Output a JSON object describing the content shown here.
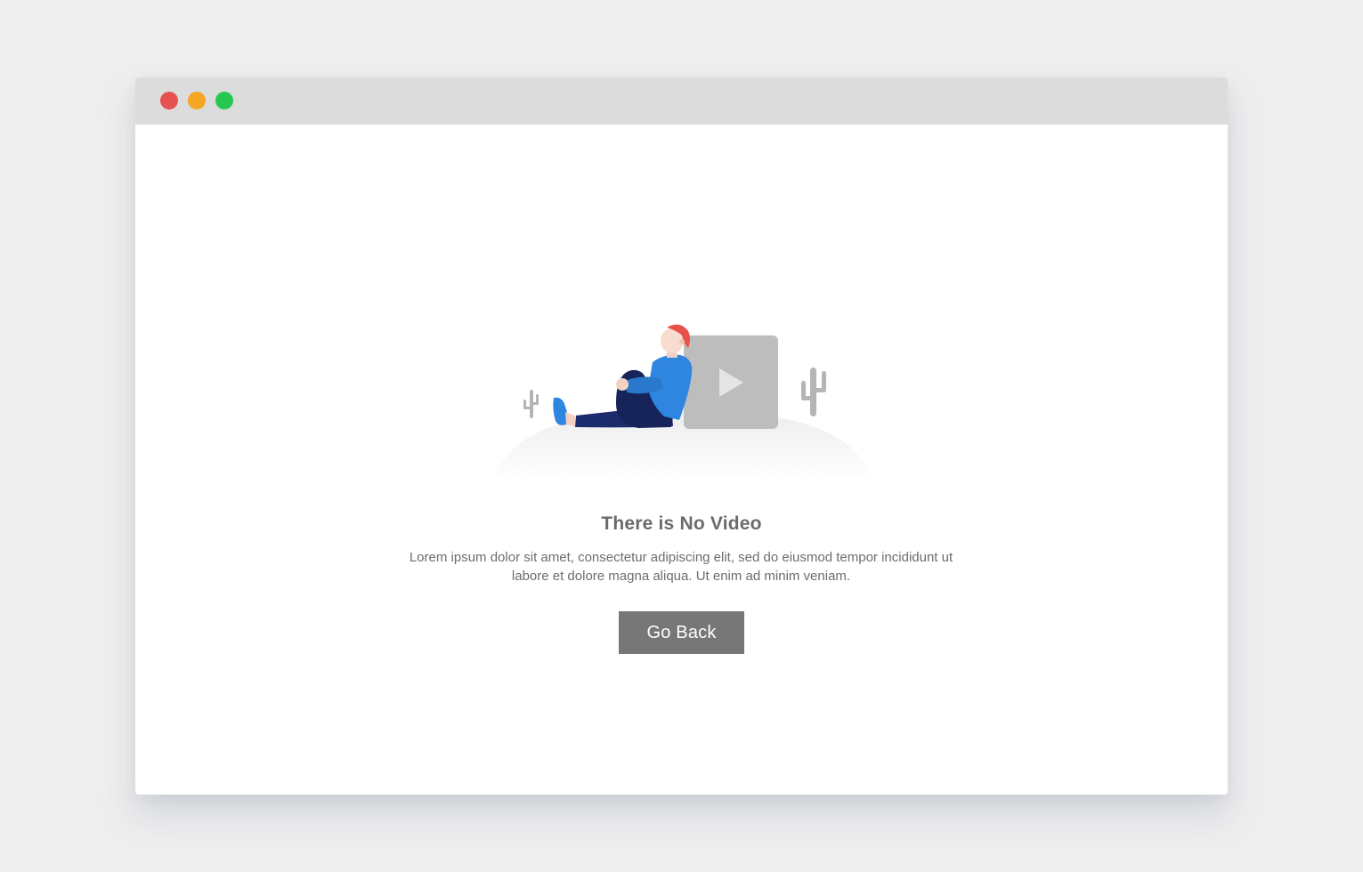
{
  "window": {
    "controls": [
      {
        "name": "close",
        "color": "#e85151"
      },
      {
        "name": "minimize",
        "color": "#f5a623"
      },
      {
        "name": "maximize",
        "color": "#27c851"
      }
    ]
  },
  "empty_state": {
    "title": "There is No Video",
    "description": "Lorem ipsum dolor sit amet, consectetur adipiscing elit, sed do eiusmod tempor incididunt ut labore et dolore magna aliqua. Ut enim ad minim veniam.",
    "button_label": "Go Back",
    "illustration_icons": [
      "person-sitting-icon",
      "video-play-icon",
      "cactus-icon"
    ]
  },
  "colors": {
    "background": "#eeeeef",
    "titlebar": "#dcdcdc",
    "button": "#777777",
    "video_placeholder": "#bdbdbd",
    "accent_blue": "#2f86e0",
    "hair_red": "#e8514a"
  }
}
